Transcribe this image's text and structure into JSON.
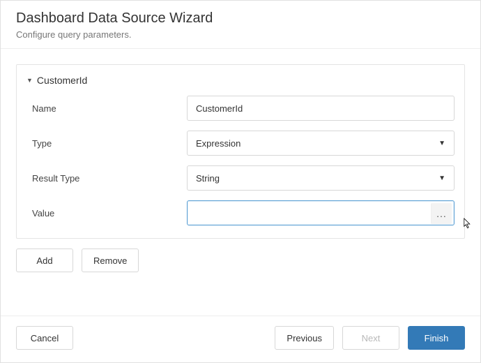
{
  "header": {
    "title": "Dashboard Data Source Wizard",
    "subtitle": "Configure query parameters."
  },
  "panel": {
    "param_name": "CustomerId",
    "fields": {
      "name": {
        "label": "Name",
        "value": "CustomerId"
      },
      "type": {
        "label": "Type",
        "value": "Expression"
      },
      "result_type": {
        "label": "Result Type",
        "value": "String"
      },
      "value": {
        "label": "Value",
        "value": "",
        "ellipsis": "..."
      }
    }
  },
  "buttons": {
    "add": "Add",
    "remove": "Remove",
    "cancel": "Cancel",
    "previous": "Previous",
    "next": "Next",
    "finish": "Finish"
  }
}
